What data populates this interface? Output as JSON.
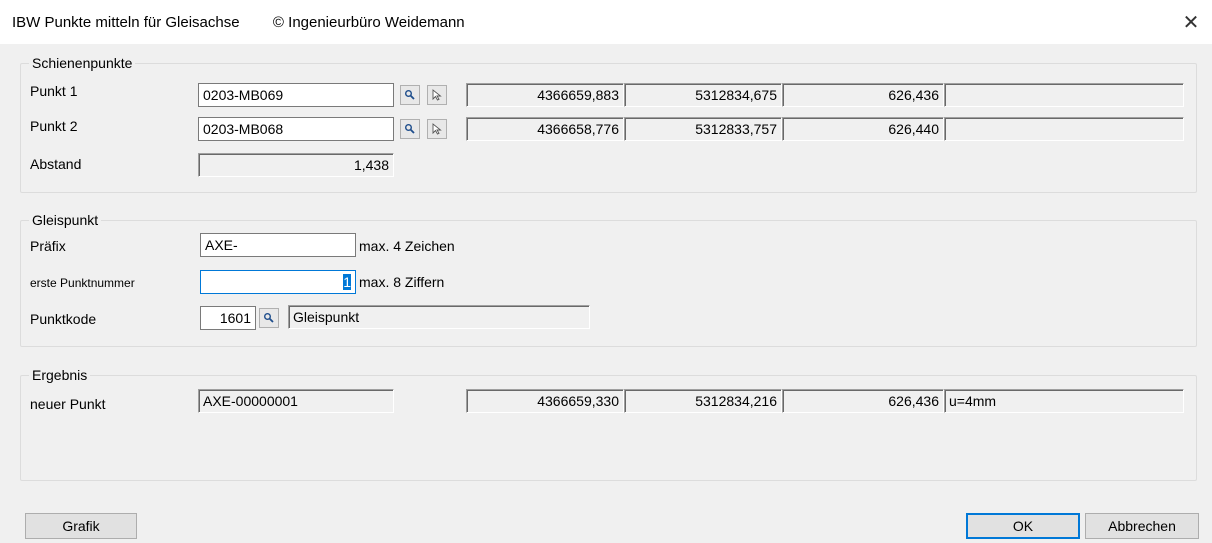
{
  "window": {
    "title": "IBW Punkte mitteln für Gleisachse        © Ingenieurbüro Weidemann",
    "close_glyph": "✕"
  },
  "schienenpunkte": {
    "legend": "Schienenpunkte",
    "punkt1": {
      "label": "Punkt 1",
      "value": "0203-MB069",
      "x": "4366659,883",
      "y": "5312834,675",
      "z": "626,436",
      "extra": ""
    },
    "punkt2": {
      "label": "Punkt 2",
      "value": "0203-MB068",
      "x": "4366658,776",
      "y": "5312833,757",
      "z": "626,440",
      "extra": ""
    },
    "abstand": {
      "label": "Abstand",
      "value": "1,438"
    }
  },
  "gleispunkt": {
    "legend": "Gleispunkt",
    "praefix": {
      "label": "Präfix",
      "value": "AXE-",
      "hint": "max. 4 Zeichen"
    },
    "punktnummer": {
      "label": "erste Punktnummer",
      "value": "1",
      "hint": "max. 8 Ziffern"
    },
    "punktkode": {
      "label": "Punktkode",
      "value": "1601",
      "description": "Gleispunkt"
    }
  },
  "ergebnis": {
    "legend": "Ergebnis",
    "neuer_punkt": {
      "label": "neuer Punkt",
      "value": "AXE-00000001",
      "x": "4366659,330",
      "y": "5312834,216",
      "z": "626,436",
      "extra": "u=4mm"
    }
  },
  "buttons": {
    "grafik": "Grafik",
    "ok": "OK",
    "abbrechen": "Abbrechen"
  },
  "colors": {
    "accent": "#0078d7",
    "dialog_bg": "#f0f0f0"
  }
}
